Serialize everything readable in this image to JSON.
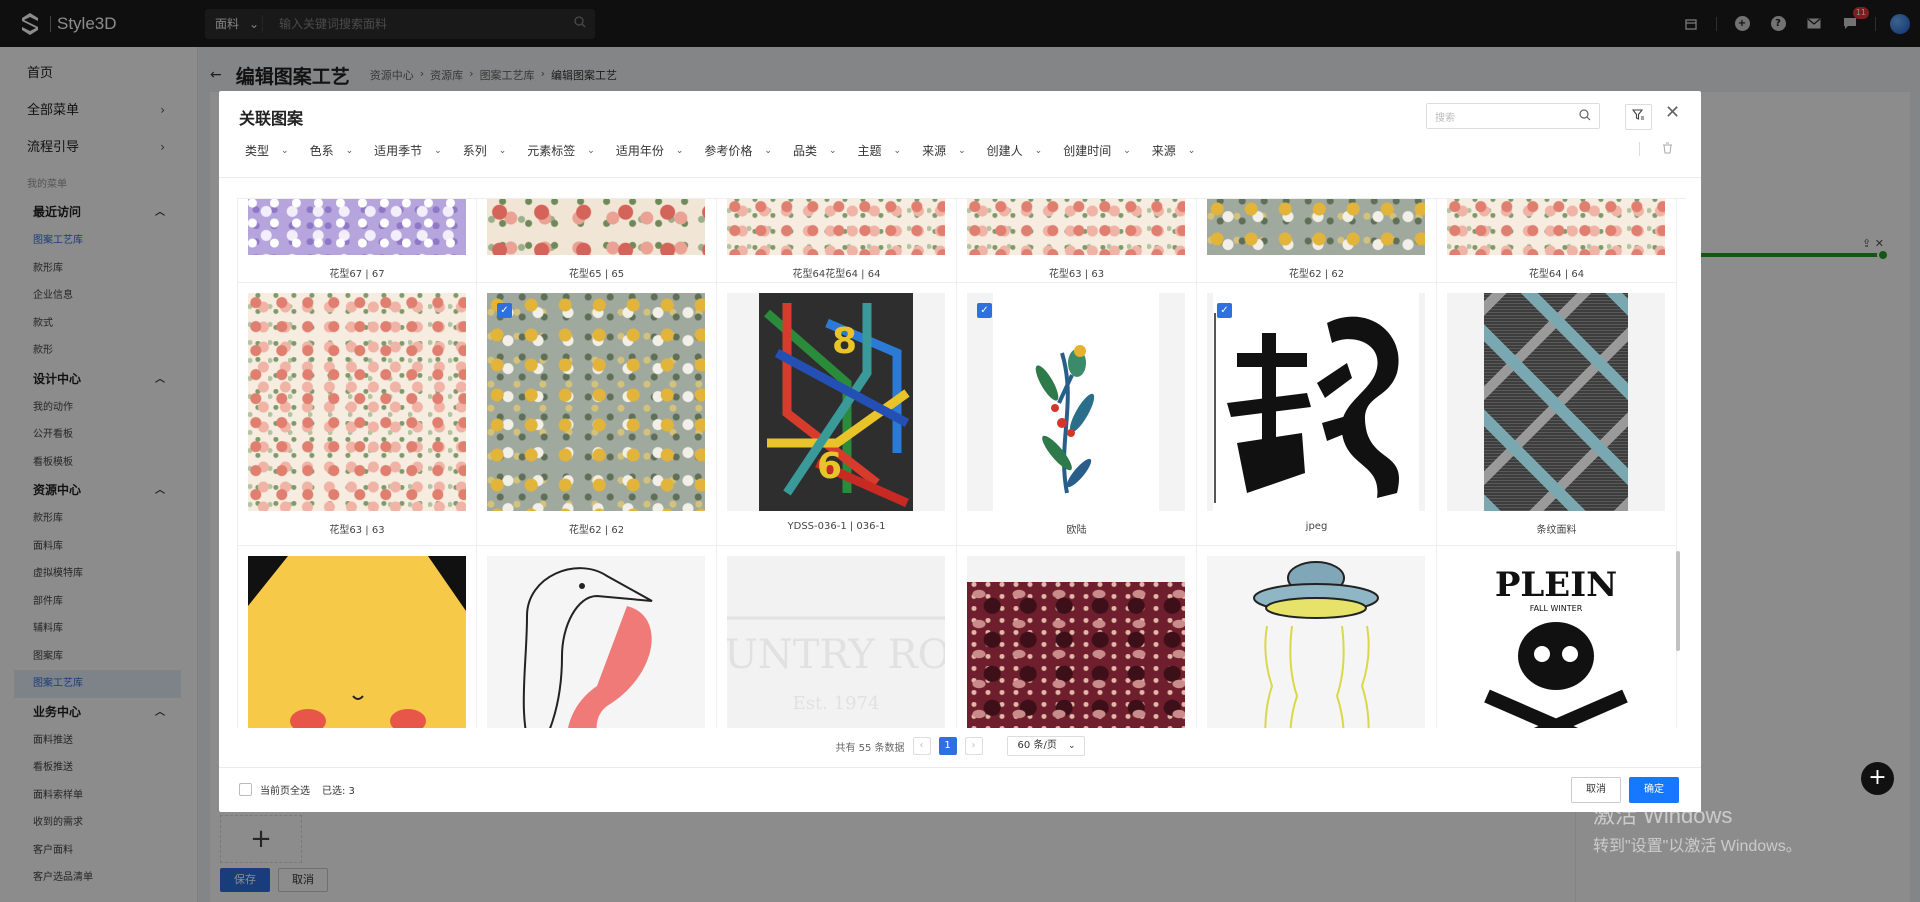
{
  "app": {
    "brand": "Style3D",
    "search_category": "面料",
    "search_placeholder": "输入关键词搜索面料",
    "notification_count": "11"
  },
  "sidebar": {
    "top_items": [
      {
        "label": "首页"
      },
      {
        "label": "全部菜单"
      },
      {
        "label": "流程引导"
      }
    ],
    "section_label": "我的菜单",
    "groups": [
      {
        "label": "最近访问",
        "items": [
          "图案工艺库",
          "款形库",
          "企业信息",
          "款式",
          "款形"
        ]
      },
      {
        "label": "设计中心",
        "items": [
          "我的动作",
          "公开看板",
          "看板模板"
        ]
      },
      {
        "label": "资源中心",
        "items": [
          "款形库",
          "面料库",
          "虚拟模特库",
          "部件库",
          "辅料库",
          "图案库",
          "图案工艺库"
        ]
      },
      {
        "label": "业务中心",
        "items": [
          "面料推送",
          "看板推送",
          "面料索样单",
          "收到的需求",
          "客户面料",
          "客户选品清单"
        ]
      }
    ]
  },
  "page": {
    "title": "编辑图案工艺",
    "breadcrumb": [
      "资源中心",
      "资源库",
      "图案工艺库",
      "编辑图案工艺"
    ],
    "save_label": "保存",
    "cancel_label": "取消"
  },
  "modal": {
    "title": "关联图案",
    "search_placeholder": "搜索",
    "filters": [
      "类型",
      "色系",
      "适用季节",
      "系列",
      "元素标签",
      "适用年份",
      "参考价格",
      "品类",
      "主题",
      "来源",
      "创建人",
      "创建时间",
      "来源"
    ],
    "rows": [
      [
        {
          "caption": "花型67 | 67",
          "pattern": "p-lav",
          "checked": false
        },
        {
          "caption": "花型65 | 65",
          "pattern": "p-rose",
          "checked": false
        },
        {
          "caption": "花型64花型64 | 64",
          "pattern": "p-rose2",
          "checked": false
        },
        {
          "caption": "花型63 | 63",
          "pattern": "p-rose2",
          "checked": false
        },
        {
          "caption": "花型62 | 62",
          "pattern": "p-gold",
          "checked": false
        },
        {
          "caption": "花型64 | 64",
          "pattern": "p-rose2",
          "checked": false
        }
      ],
      [
        {
          "caption": "花型63 | 63",
          "pattern": "p-rose2",
          "checked": false
        },
        {
          "caption": "花型62 | 62",
          "pattern": "p-gold",
          "checked": true
        },
        {
          "caption": "YDSS-036-1 | 036-1",
          "pattern": "pipes",
          "checked": false
        },
        {
          "caption": "欧陆",
          "pattern": "bird",
          "checked": true
        },
        {
          "caption": "jpeg",
          "pattern": "dragon",
          "checked": true
        },
        {
          "caption": "条纹面料",
          "pattern": "p-cross",
          "checked": false
        }
      ],
      [
        {
          "caption": "",
          "pattern": "pikachu",
          "checked": false
        },
        {
          "caption": "",
          "pattern": "toucan",
          "checked": false
        },
        {
          "caption": "",
          "pattern": "country",
          "checked": false,
          "text": "COUNTRY ROAD",
          "subtext": "Est. 1974"
        },
        {
          "caption": "",
          "pattern": "p-paisley",
          "checked": false
        },
        {
          "caption": "",
          "pattern": "ufo",
          "checked": false
        },
        {
          "caption": "",
          "pattern": "skull",
          "checked": false,
          "text": "PLEIN",
          "subtext": "FALL WINTER"
        }
      ]
    ],
    "pager": {
      "total_text": "共有 55 条数据",
      "current_page": "1",
      "page_size": "60 条/页"
    },
    "select_all_label": "当前页全选",
    "selected_text": "已选: 3",
    "cancel_label": "取消",
    "confirm_label": "确定"
  },
  "watermark": {
    "line1": "激活 Windows",
    "line2": "转到\"设置\"以激活 Windows。"
  }
}
